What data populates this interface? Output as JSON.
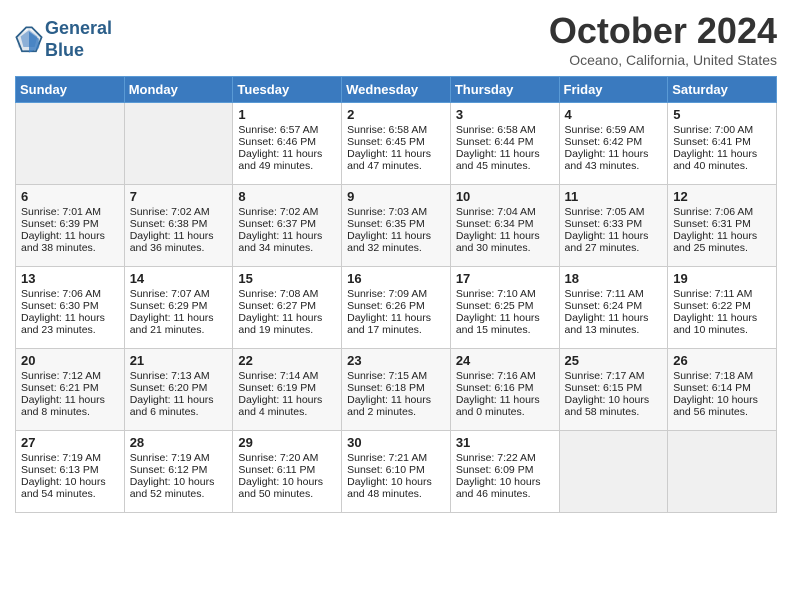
{
  "header": {
    "logo_line1": "General",
    "logo_line2": "Blue",
    "title": "October 2024",
    "subtitle": "Oceano, California, United States"
  },
  "weekdays": [
    "Sunday",
    "Monday",
    "Tuesday",
    "Wednesday",
    "Thursday",
    "Friday",
    "Saturday"
  ],
  "weeks": [
    [
      {
        "day": "",
        "lines": []
      },
      {
        "day": "",
        "lines": []
      },
      {
        "day": "1",
        "lines": [
          "Sunrise: 6:57 AM",
          "Sunset: 6:46 PM",
          "Daylight: 11 hours",
          "and 49 minutes."
        ]
      },
      {
        "day": "2",
        "lines": [
          "Sunrise: 6:58 AM",
          "Sunset: 6:45 PM",
          "Daylight: 11 hours",
          "and 47 minutes."
        ]
      },
      {
        "day": "3",
        "lines": [
          "Sunrise: 6:58 AM",
          "Sunset: 6:44 PM",
          "Daylight: 11 hours",
          "and 45 minutes."
        ]
      },
      {
        "day": "4",
        "lines": [
          "Sunrise: 6:59 AM",
          "Sunset: 6:42 PM",
          "Daylight: 11 hours",
          "and 43 minutes."
        ]
      },
      {
        "day": "5",
        "lines": [
          "Sunrise: 7:00 AM",
          "Sunset: 6:41 PM",
          "Daylight: 11 hours",
          "and 40 minutes."
        ]
      }
    ],
    [
      {
        "day": "6",
        "lines": [
          "Sunrise: 7:01 AM",
          "Sunset: 6:39 PM",
          "Daylight: 11 hours",
          "and 38 minutes."
        ]
      },
      {
        "day": "7",
        "lines": [
          "Sunrise: 7:02 AM",
          "Sunset: 6:38 PM",
          "Daylight: 11 hours",
          "and 36 minutes."
        ]
      },
      {
        "day": "8",
        "lines": [
          "Sunrise: 7:02 AM",
          "Sunset: 6:37 PM",
          "Daylight: 11 hours",
          "and 34 minutes."
        ]
      },
      {
        "day": "9",
        "lines": [
          "Sunrise: 7:03 AM",
          "Sunset: 6:35 PM",
          "Daylight: 11 hours",
          "and 32 minutes."
        ]
      },
      {
        "day": "10",
        "lines": [
          "Sunrise: 7:04 AM",
          "Sunset: 6:34 PM",
          "Daylight: 11 hours",
          "and 30 minutes."
        ]
      },
      {
        "day": "11",
        "lines": [
          "Sunrise: 7:05 AM",
          "Sunset: 6:33 PM",
          "Daylight: 11 hours",
          "and 27 minutes."
        ]
      },
      {
        "day": "12",
        "lines": [
          "Sunrise: 7:06 AM",
          "Sunset: 6:31 PM",
          "Daylight: 11 hours",
          "and 25 minutes."
        ]
      }
    ],
    [
      {
        "day": "13",
        "lines": [
          "Sunrise: 7:06 AM",
          "Sunset: 6:30 PM",
          "Daylight: 11 hours",
          "and 23 minutes."
        ]
      },
      {
        "day": "14",
        "lines": [
          "Sunrise: 7:07 AM",
          "Sunset: 6:29 PM",
          "Daylight: 11 hours",
          "and 21 minutes."
        ]
      },
      {
        "day": "15",
        "lines": [
          "Sunrise: 7:08 AM",
          "Sunset: 6:27 PM",
          "Daylight: 11 hours",
          "and 19 minutes."
        ]
      },
      {
        "day": "16",
        "lines": [
          "Sunrise: 7:09 AM",
          "Sunset: 6:26 PM",
          "Daylight: 11 hours",
          "and 17 minutes."
        ]
      },
      {
        "day": "17",
        "lines": [
          "Sunrise: 7:10 AM",
          "Sunset: 6:25 PM",
          "Daylight: 11 hours",
          "and 15 minutes."
        ]
      },
      {
        "day": "18",
        "lines": [
          "Sunrise: 7:11 AM",
          "Sunset: 6:24 PM",
          "Daylight: 11 hours",
          "and 13 minutes."
        ]
      },
      {
        "day": "19",
        "lines": [
          "Sunrise: 7:11 AM",
          "Sunset: 6:22 PM",
          "Daylight: 11 hours",
          "and 10 minutes."
        ]
      }
    ],
    [
      {
        "day": "20",
        "lines": [
          "Sunrise: 7:12 AM",
          "Sunset: 6:21 PM",
          "Daylight: 11 hours",
          "and 8 minutes."
        ]
      },
      {
        "day": "21",
        "lines": [
          "Sunrise: 7:13 AM",
          "Sunset: 6:20 PM",
          "Daylight: 11 hours",
          "and 6 minutes."
        ]
      },
      {
        "day": "22",
        "lines": [
          "Sunrise: 7:14 AM",
          "Sunset: 6:19 PM",
          "Daylight: 11 hours",
          "and 4 minutes."
        ]
      },
      {
        "day": "23",
        "lines": [
          "Sunrise: 7:15 AM",
          "Sunset: 6:18 PM",
          "Daylight: 11 hours",
          "and 2 minutes."
        ]
      },
      {
        "day": "24",
        "lines": [
          "Sunrise: 7:16 AM",
          "Sunset: 6:16 PM",
          "Daylight: 11 hours",
          "and 0 minutes."
        ]
      },
      {
        "day": "25",
        "lines": [
          "Sunrise: 7:17 AM",
          "Sunset: 6:15 PM",
          "Daylight: 10 hours",
          "and 58 minutes."
        ]
      },
      {
        "day": "26",
        "lines": [
          "Sunrise: 7:18 AM",
          "Sunset: 6:14 PM",
          "Daylight: 10 hours",
          "and 56 minutes."
        ]
      }
    ],
    [
      {
        "day": "27",
        "lines": [
          "Sunrise: 7:19 AM",
          "Sunset: 6:13 PM",
          "Daylight: 10 hours",
          "and 54 minutes."
        ]
      },
      {
        "day": "28",
        "lines": [
          "Sunrise: 7:19 AM",
          "Sunset: 6:12 PM",
          "Daylight: 10 hours",
          "and 52 minutes."
        ]
      },
      {
        "day": "29",
        "lines": [
          "Sunrise: 7:20 AM",
          "Sunset: 6:11 PM",
          "Daylight: 10 hours",
          "and 50 minutes."
        ]
      },
      {
        "day": "30",
        "lines": [
          "Sunrise: 7:21 AM",
          "Sunset: 6:10 PM",
          "Daylight: 10 hours",
          "and 48 minutes."
        ]
      },
      {
        "day": "31",
        "lines": [
          "Sunrise: 7:22 AM",
          "Sunset: 6:09 PM",
          "Daylight: 10 hours",
          "and 46 minutes."
        ]
      },
      {
        "day": "",
        "lines": []
      },
      {
        "day": "",
        "lines": []
      }
    ]
  ]
}
